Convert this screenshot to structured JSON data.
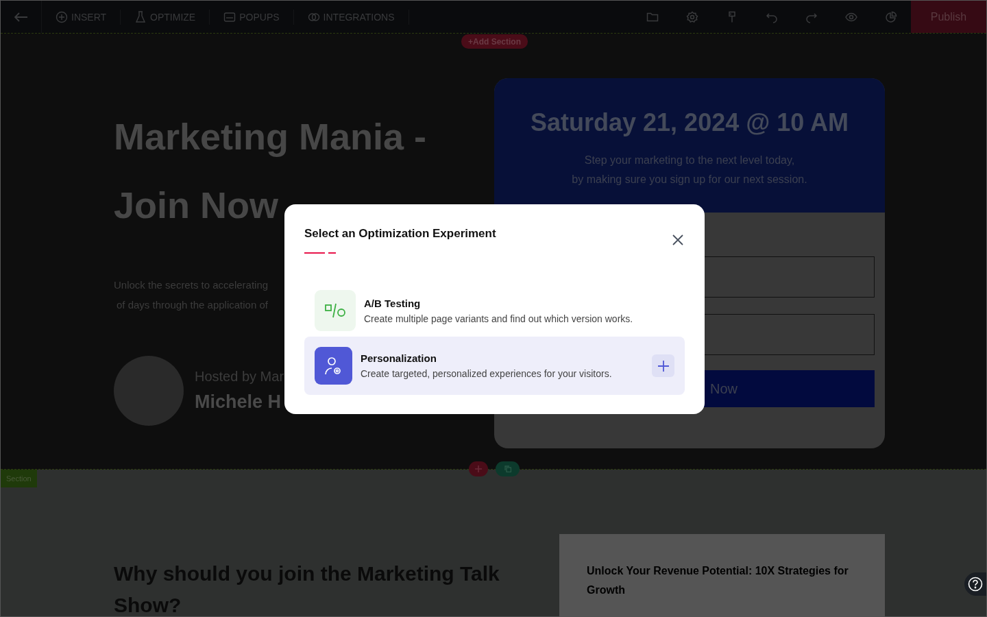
{
  "toolbar": {
    "menu": [
      {
        "label": "INSERT"
      },
      {
        "label": "OPTIMIZE"
      },
      {
        "label": "POPUPS"
      },
      {
        "label": "INTEGRATIONS"
      }
    ],
    "publish": "Publish"
  },
  "canvas": {
    "add_section": "+Add Section",
    "hero": {
      "title_lines": [
        "Marketing Mania -",
        "Join Now"
      ],
      "intro_lines": [
        "Unlock the secrets to accelerating",
        "of days through the application of"
      ],
      "host_label": "Hosted by Mar",
      "host_name": "Michele H",
      "card": {
        "date": "Saturday 21, 2024 @ 10 AM",
        "subtitle_lines": [
          "Step your marketing to the next level today,",
          "by making sure you sign up for our next session."
        ],
        "button": "Now"
      }
    },
    "section_label": "Section",
    "lower": {
      "heading": "Why should you join the Marketing Talk Show?",
      "card_title": "Unlock Your Revenue Potential: 10X Strategies for Growth"
    }
  },
  "modal": {
    "title": "Select an Optimization Experiment",
    "options": [
      {
        "kind": "ab",
        "title": "A/B Testing",
        "description": "Create multiple page variants and find out which version works.",
        "selected": false
      },
      {
        "kind": "person",
        "title": "Personalization",
        "description": "Create targeted, personalized experiences for your visitors.",
        "selected": true
      }
    ]
  }
}
